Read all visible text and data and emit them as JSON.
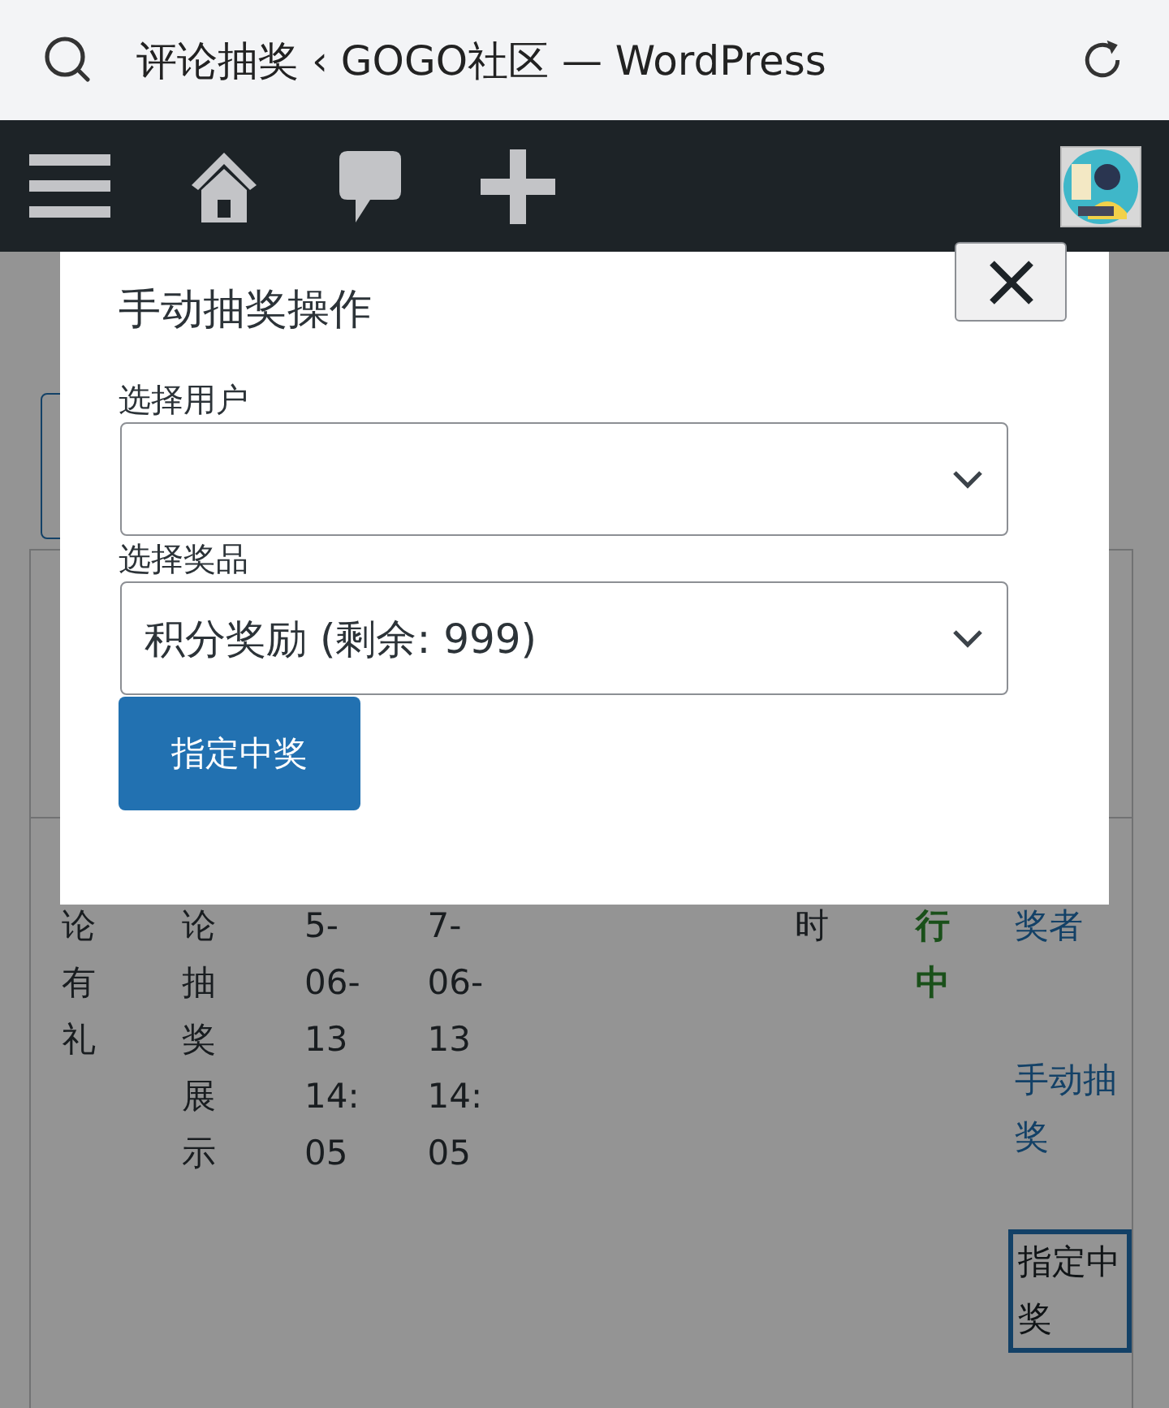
{
  "browser": {
    "title": "评论抽奖 ‹ GOGO社区 — WordPress"
  },
  "table_row": {
    "cells": [
      {
        "kind": "text",
        "text": "论有礼"
      },
      {
        "kind": "text",
        "text": "论抽奖展示"
      },
      {
        "kind": "date",
        "text": "5-06-13 14:05"
      },
      {
        "kind": "date",
        "text": "7-06-13 14:05"
      },
      {
        "kind": "text",
        "text": "时"
      },
      {
        "kind": "status",
        "text": "行中"
      },
      {
        "kind": "actions",
        "links": [
          "奖者",
          "手动抽奖"
        ],
        "button": "指定中奖"
      }
    ]
  },
  "modal": {
    "title": "手动抽奖操作",
    "fields": [
      {
        "label": "选择用户"
      },
      {
        "label": "选择奖品",
        "value": "积分奖励 (剩余: 999)"
      }
    ],
    "submit": "指定中奖"
  }
}
